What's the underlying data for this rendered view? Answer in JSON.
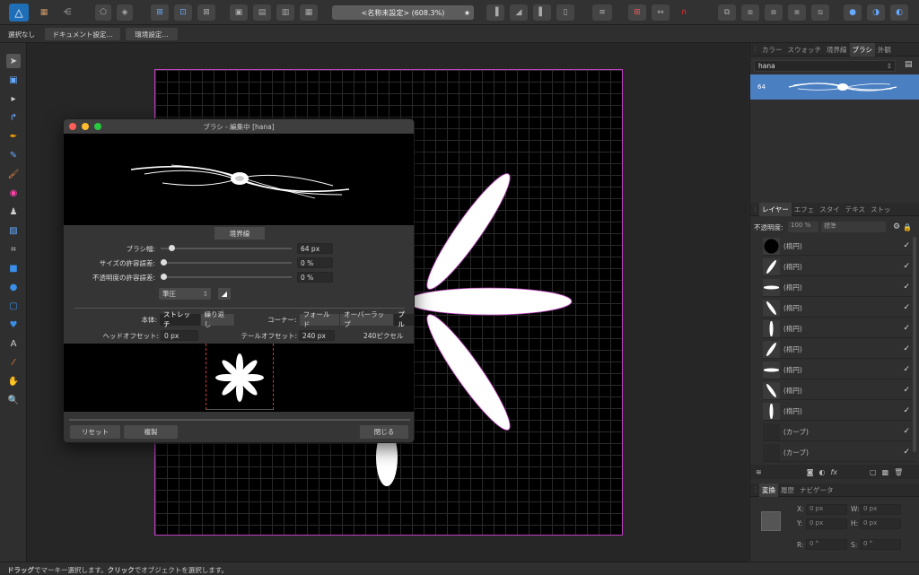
{
  "document": {
    "title": "<名称未設定> (608.3%)"
  },
  "context_bar": {
    "selection": "選択なし",
    "doc_settings": "ドキュメント設定...",
    "prefs": "環境設定..."
  },
  "right_panel": {
    "top_tabs": [
      "カラー",
      "スウォッチ",
      "境界線",
      "ブラシ",
      "外観"
    ],
    "brush_category": "hana",
    "brush_size": "64",
    "layer_tabs": [
      "レイヤー",
      "エフェ",
      "スタイ",
      "テキス",
      "ストッ"
    ],
    "opacity_label": "不透明度:",
    "opacity_value": "100 %",
    "blend_mode": "標準",
    "layers": [
      {
        "name": "(楕円)",
        "thumb": "circle"
      },
      {
        "name": "(楕円)",
        "thumb": "petal-diag"
      },
      {
        "name": "(楕円)",
        "thumb": "petal-h"
      },
      {
        "name": "(楕円)",
        "thumb": "petal-diag2"
      },
      {
        "name": "(楕円)",
        "thumb": "petal-v"
      },
      {
        "name": "(楕円)",
        "thumb": "petal-diag"
      },
      {
        "name": "(楕円)",
        "thumb": "petal-h"
      },
      {
        "name": "(楕円)",
        "thumb": "petal-diag2"
      },
      {
        "name": "(楕円)",
        "thumb": "petal-v"
      },
      {
        "name": "(カーブ)",
        "thumb": "empty"
      },
      {
        "name": "(カーブ)",
        "thumb": "empty"
      }
    ],
    "transform_tabs": [
      "変換",
      "履歴",
      "ナビゲータ"
    ],
    "transform": {
      "x": "0 px",
      "y": "0 px",
      "w": "0 px",
      "h": "0 px",
      "r": "0 °",
      "s": "0 °"
    },
    "labels": {
      "x": "X:",
      "y": "Y:",
      "w": "W:",
      "h": "H:",
      "r": "R:",
      "s": "S:"
    }
  },
  "dialog": {
    "title": "ブラシ - 編集中 [hana]",
    "section": "境界線",
    "width_label": "ブラシ幅:",
    "width_value": "64 px",
    "width_fraction": 0.06,
    "size_var_label": "サイズの許容誤差:",
    "size_var_value": "0 %",
    "opacity_var_label": "不透明度の許容誤差:",
    "opacity_var_value": "0 %",
    "pressure": "筆圧",
    "body_label": "本体:",
    "body_options": [
      "ストレッチ",
      "繰り返し"
    ],
    "corner_label": "コーナー:",
    "corner_options": [
      "フォールド",
      "オーバーラップ",
      "プル"
    ],
    "head_label": "ヘッドオフセット:",
    "head_value": "0 px",
    "tail_label": "テールオフセット:",
    "tail_value": "240 px",
    "tail_pixels": "240ピクセル",
    "reset": "リセット",
    "duplicate": "複製",
    "close": "閉じる"
  },
  "status": {
    "drag": "ドラッグ",
    "drag_text": "でマーキー選択します。",
    "click": "クリック",
    "click_text": "でオブジェクトを選択します。"
  },
  "colors": {
    "accent": "#4a7fc1",
    "selection": "#c040c0",
    "red": "#ff5f57",
    "yellow": "#febc2e",
    "green": "#28c840"
  }
}
